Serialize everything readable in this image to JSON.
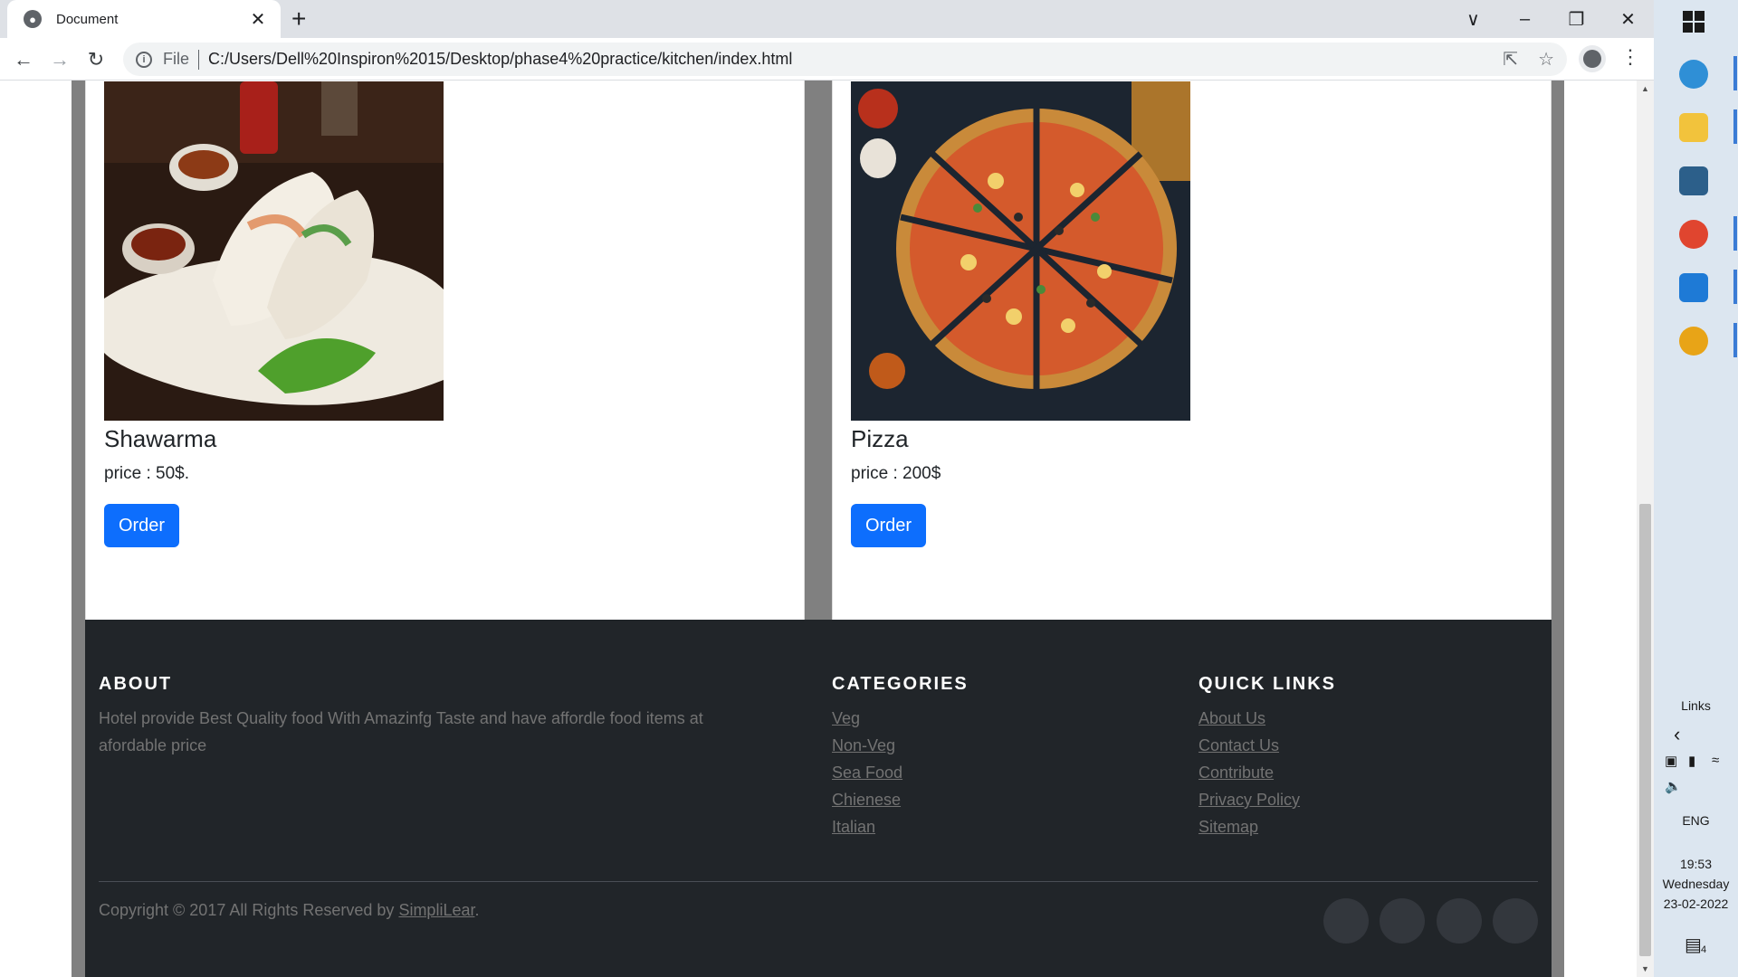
{
  "browser": {
    "tab_title": "Document",
    "tab_favicon_glyph": "●",
    "tab_close": "✕",
    "new_tab": "+",
    "window_controls": [
      "∨",
      "–",
      "❐",
      "✕"
    ],
    "nav": {
      "back": "←",
      "forward": "→",
      "reload": "↻"
    },
    "omnibox": {
      "info_glyph": "i",
      "scheme": "File",
      "url": "C:/Users/Dell%20Inspiron%2015/Desktop/phase4%20practice/kitchen/index.html",
      "share_glyph": "⇱",
      "star_glyph": "☆"
    },
    "kebab": "⋮"
  },
  "products": [
    {
      "name": "Shawarma",
      "price": "price : 50$.",
      "button": "Order"
    },
    {
      "name": "Pizza",
      "price": "price : 200$",
      "button": "Order"
    }
  ],
  "footer": {
    "about": {
      "heading": "ABOUT",
      "text": "Hotel provide Best Quality food With Amazinfg Taste and have affordle food items at afordable price"
    },
    "categories": {
      "heading": "CATEGORIES",
      "items": [
        "Veg",
        "Non-Veg",
        "Sea Food",
        "Chienese",
        "Italian"
      ]
    },
    "quick_links": {
      "heading": "QUICK LINKS",
      "items": [
        "About Us",
        "Contact Us",
        "Contribute",
        "Privacy Policy",
        "Sitemap"
      ]
    },
    "copyright_prefix": "Copyright © 2017 All Rights Reserved by ",
    "copyright_link": "SimpliLear",
    "copyright_suffix": "."
  },
  "taskbar": {
    "links_label": "Links",
    "chevron": "‹",
    "language": "ENG",
    "time": "19:53",
    "day": "Wednesday",
    "date": "23-02-2022",
    "notification_count": "4",
    "icons": [
      "windows-start-icon",
      "edge-icon",
      "file-explorer-icon",
      "mysql-workbench-icon",
      "chrome-profile-icon",
      "vscode-icon",
      "chrome-icon"
    ],
    "colors": {
      "accent": "#3a7bd5",
      "taskbar_bg": "#dce6f0"
    }
  },
  "colors": {
    "order_button": "#0d6efd",
    "footer_bg": "#212529",
    "page_grey": "#808080",
    "muted_text": "#737373"
  }
}
